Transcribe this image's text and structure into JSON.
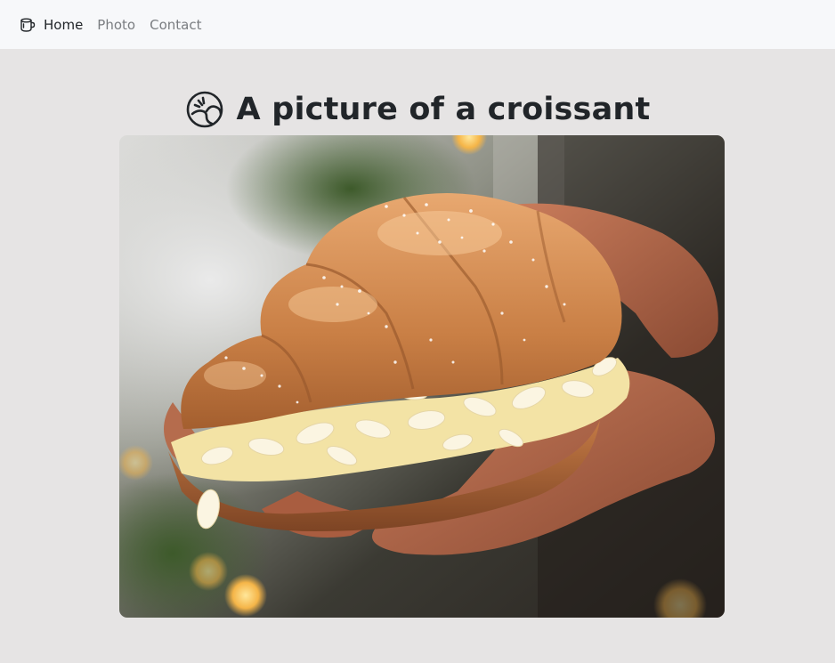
{
  "nav": {
    "brand_icon": "mug-icon",
    "items": [
      {
        "label": "Home",
        "active": true
      },
      {
        "label": "Photo",
        "active": false
      },
      {
        "label": "Contact",
        "active": false
      }
    ]
  },
  "header": {
    "icon": "croissant-icon",
    "title": "A picture of a croissant"
  },
  "photo": {
    "subject": "croissant-photo"
  },
  "colors": {
    "page_bg": "#e6e4e4",
    "navbar_bg": "#f7f8fa",
    "text_dark": "#212529",
    "text_muted": "#7a7d81"
  }
}
